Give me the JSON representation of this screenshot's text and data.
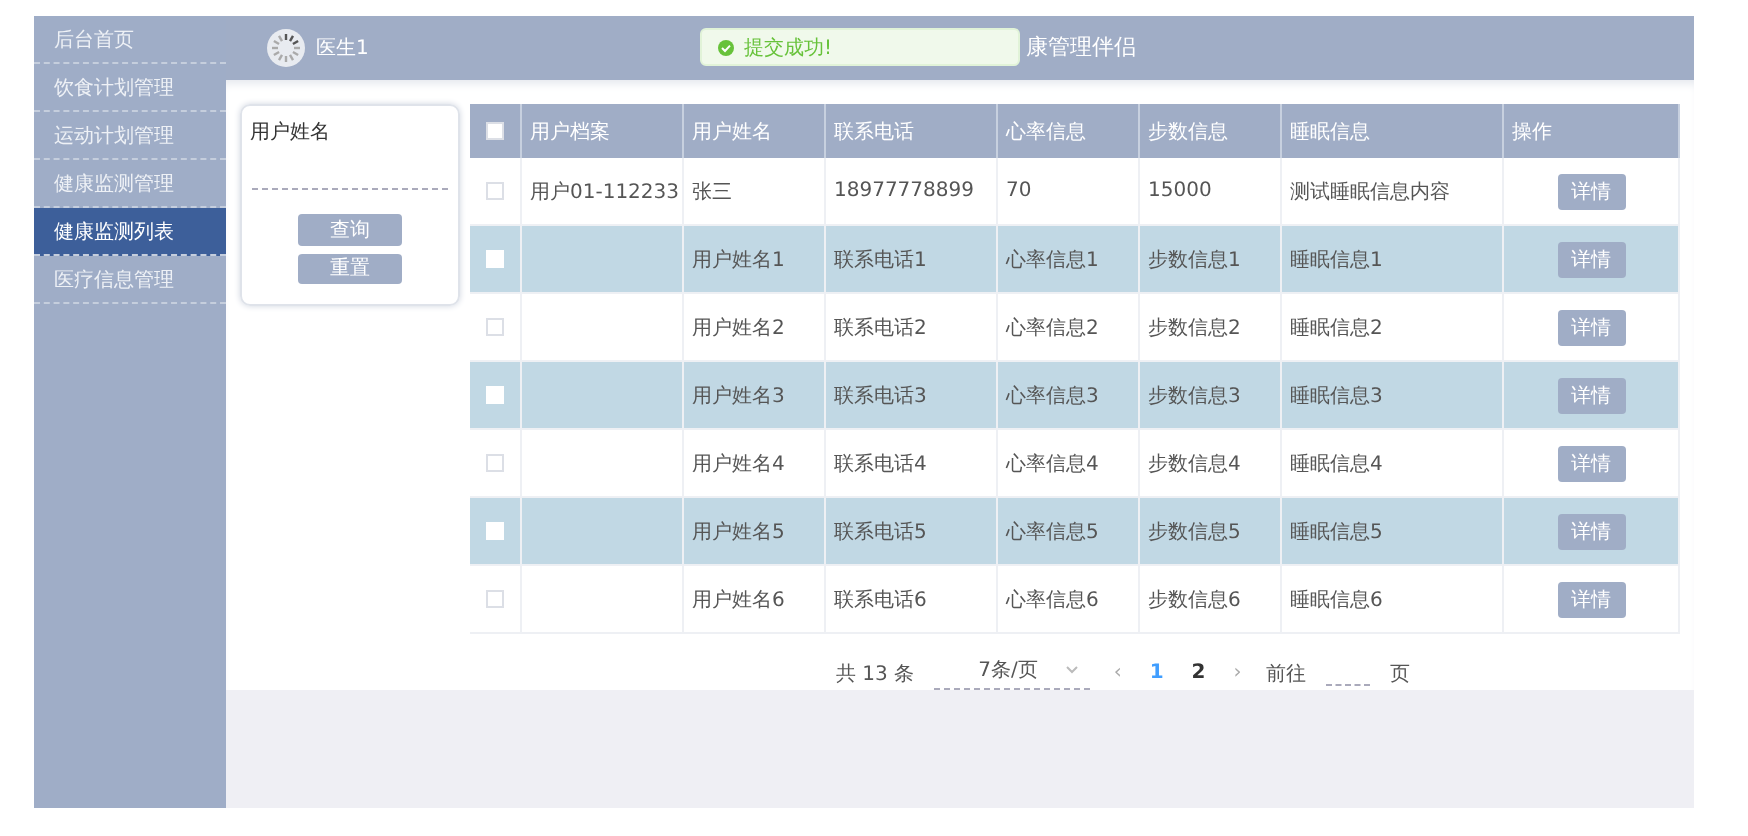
{
  "sidebar": {
    "items": [
      {
        "label": "后台首页",
        "selected": false
      },
      {
        "label": "饮食计划管理",
        "selected": false
      },
      {
        "label": "运动计划管理",
        "selected": false
      },
      {
        "label": "健康监测管理",
        "selected": false
      },
      {
        "label": "健康监测列表",
        "selected": true
      },
      {
        "label": "医疗信息管理",
        "selected": false
      }
    ]
  },
  "header": {
    "user": "医生1",
    "title": "康管理伴侣"
  },
  "toast": {
    "message": "提交成功!"
  },
  "search": {
    "label": "用户姓名",
    "buttons": [
      "查询",
      "重置"
    ]
  },
  "table": {
    "all_checked": false,
    "columns": [
      "用户档案",
      "用户姓名",
      "联系电话",
      "心率信息",
      "步数信息",
      "睡眠信息",
      "操作"
    ],
    "rows": [
      {
        "cells": [
          "用户01-112233",
          "张三",
          "18977778899",
          "70",
          "15000",
          "测试睡眠信息内容"
        ],
        "action": "详情",
        "highlighted": false
      },
      {
        "cells": [
          "",
          "用户姓名1",
          "联系电话1",
          "心率信息1",
          "步数信息1",
          "睡眠信息1"
        ],
        "action": "详情",
        "highlighted": true
      },
      {
        "cells": [
          "",
          "用户姓名2",
          "联系电话2",
          "心率信息2",
          "步数信息2",
          "睡眠信息2"
        ],
        "action": "详情",
        "highlighted": false
      },
      {
        "cells": [
          "",
          "用户姓名3",
          "联系电话3",
          "心率信息3",
          "步数信息3",
          "睡眠信息3"
        ],
        "action": "详情",
        "highlighted": true
      },
      {
        "cells": [
          "",
          "用户姓名4",
          "联系电话4",
          "心率信息4",
          "步数信息4",
          "睡眠信息4"
        ],
        "action": "详情",
        "highlighted": false
      },
      {
        "cells": [
          "",
          "用户姓名5",
          "联系电话5",
          "心率信息5",
          "步数信息5",
          "睡眠信息5"
        ],
        "action": "详情",
        "highlighted": true
      },
      {
        "cells": [
          "",
          "用户姓名6",
          "联系电话6",
          "心率信息6",
          "步数信息6",
          "睡眠信息6"
        ],
        "action": "详情",
        "highlighted": false
      }
    ]
  },
  "pagination": {
    "total": "共 13 条",
    "page_size": "7条/页",
    "pages": [
      {
        "label": "1",
        "selected": true
      },
      {
        "label": "2",
        "selected": false
      }
    ],
    "prev": "‹",
    "next": "›",
    "goto": "前往",
    "page_unit": "页"
  }
}
